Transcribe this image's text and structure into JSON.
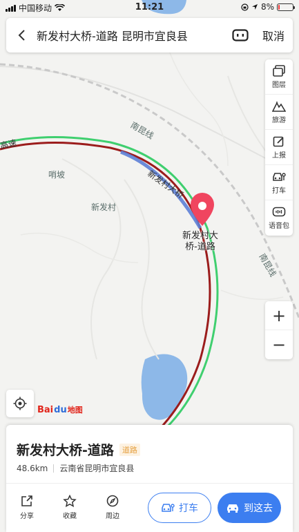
{
  "status_bar": {
    "carrier": "中国移动",
    "time": "11:21",
    "battery": "8%"
  },
  "search": {
    "query": "新发村大桥-道路 昆明市宜良县",
    "cancel_label": "取消"
  },
  "toolbar": {
    "items": [
      {
        "label": "图层",
        "icon": "layers-icon"
      },
      {
        "label": "旅游",
        "icon": "tourism-icon"
      },
      {
        "label": "上报",
        "icon": "report-icon"
      },
      {
        "label": "打车",
        "icon": "taxi-icon"
      },
      {
        "label": "语音包",
        "icon": "voice-pack-icon"
      }
    ]
  },
  "zoom": {
    "in": "+",
    "out": "−"
  },
  "map": {
    "labels": {
      "railway": "南昆线",
      "railway2": "南昆线",
      "village1": "哨坡",
      "village2": "新发村",
      "bridge_road": "新发村大桥",
      "highway": "高速"
    },
    "poi_label": "新发村大桥-道路",
    "logo": {
      "bai": "Bai",
      "paw": "du",
      "map": "地图"
    },
    "colors": {
      "route_red": "#9b1c1c",
      "route_green": "#3fcf6f",
      "pin": "#f0455f",
      "water": "#8db8e8"
    }
  },
  "place": {
    "name": "新发村大桥-道路",
    "tag": "道路",
    "distance": "48.6km",
    "address": "云南省昆明市宜良县"
  },
  "actions": [
    {
      "label": "分享",
      "icon": "share-icon"
    },
    {
      "label": "收藏",
      "icon": "star-icon"
    },
    {
      "label": "周边",
      "icon": "compass-icon"
    }
  ],
  "buttons": {
    "taxi": "打车",
    "go": "到这去"
  }
}
